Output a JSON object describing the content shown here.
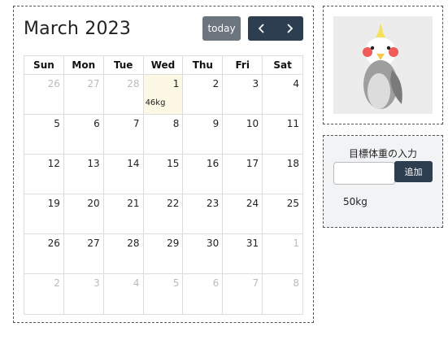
{
  "calendar": {
    "title": "March 2023",
    "today_label": "today",
    "weekdays": [
      "Sun",
      "Mon",
      "Tue",
      "Wed",
      "Thu",
      "Fri",
      "Sat"
    ],
    "days": [
      {
        "day": "26",
        "other": true
      },
      {
        "day": "27",
        "other": true
      },
      {
        "day": "28",
        "other": true
      },
      {
        "day": "1",
        "today": true,
        "event": "46kg"
      },
      {
        "day": "2"
      },
      {
        "day": "3"
      },
      {
        "day": "4"
      },
      {
        "day": "5"
      },
      {
        "day": "6"
      },
      {
        "day": "7"
      },
      {
        "day": "8"
      },
      {
        "day": "9"
      },
      {
        "day": "10"
      },
      {
        "day": "11"
      },
      {
        "day": "12"
      },
      {
        "day": "13"
      },
      {
        "day": "14"
      },
      {
        "day": "15"
      },
      {
        "day": "16"
      },
      {
        "day": "17"
      },
      {
        "day": "18"
      },
      {
        "day": "19"
      },
      {
        "day": "20"
      },
      {
        "day": "21"
      },
      {
        "day": "22"
      },
      {
        "day": "23"
      },
      {
        "day": "24"
      },
      {
        "day": "25"
      },
      {
        "day": "26"
      },
      {
        "day": "27"
      },
      {
        "day": "28"
      },
      {
        "day": "29"
      },
      {
        "day": "30"
      },
      {
        "day": "31"
      },
      {
        "day": "1",
        "other": true
      },
      {
        "day": "2",
        "other": true
      },
      {
        "day": "3",
        "other": true
      },
      {
        "day": "4",
        "other": true
      },
      {
        "day": "5",
        "other": true
      },
      {
        "day": "6",
        "other": true
      },
      {
        "day": "7",
        "other": true
      },
      {
        "day": "8",
        "other": true
      }
    ]
  },
  "weight": {
    "label": "目標体重の入力",
    "input_value": "",
    "input_placeholder": "",
    "add_label": "追加",
    "current": "50kg"
  },
  "icons": {
    "prev": "chevron-left-icon",
    "next": "chevron-right-icon",
    "bird": "cockatiel-bird-icon"
  },
  "colors": {
    "nav_dark": "#2c3e50",
    "today_button": "#6c757d",
    "today_highlight": "#fcf8e3",
    "bird_cheek": "#ef5b5b",
    "bird_crest": "#f7e15a"
  }
}
